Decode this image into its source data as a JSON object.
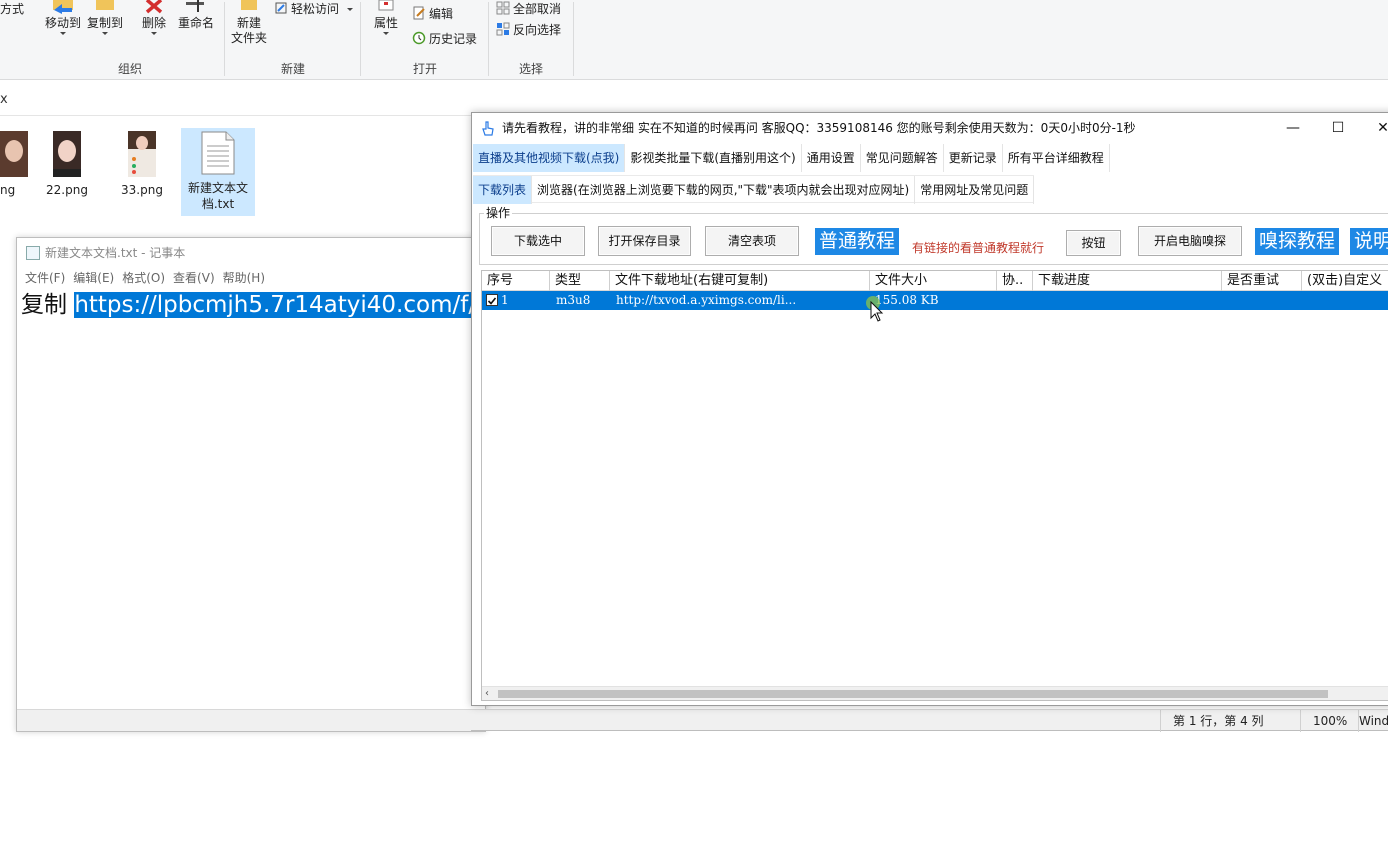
{
  "explorer": {
    "ribbon": {
      "partial_label": "方式",
      "organize": {
        "move_to": "移动到",
        "copy_to": "复制到",
        "delete": "删除",
        "rename": "重命名",
        "group": "组织"
      },
      "new": {
        "new_folder_line1": "新建",
        "new_folder_line2": "文件夹",
        "easy_access": "轻松访问",
        "group": "新建"
      },
      "open": {
        "properties": "属性",
        "edit": "编辑",
        "history": "历史记录",
        "group": "打开"
      },
      "select": {
        "select_none": "全部取消",
        "invert": "反向选择",
        "group": "选择"
      }
    },
    "address_partial": "x",
    "files": [
      {
        "name": "ng",
        "type": "image"
      },
      {
        "name": "22.png",
        "type": "image"
      },
      {
        "name": "33.png",
        "type": "image"
      },
      {
        "name": "新建文本文档.txt",
        "line1": "新建文本文",
        "line2": "档.txt",
        "type": "text",
        "selected": true
      }
    ]
  },
  "notepad": {
    "title": "新建文本文档.txt - 记事本",
    "menu": [
      "文件(F)",
      "编辑(E)",
      "格式(O)",
      "查看(V)",
      "帮助(H)"
    ],
    "text_prefix": "复制 ",
    "text_selected": "https://lpbcmjh5.7r14atyi40.com/f/",
    "status": {
      "position": "第 1 行，第 4 列",
      "zoom": "100%",
      "encoding_partial": "Wind"
    }
  },
  "downloader": {
    "title": "请先看教程，讲的非常细  实在不知道的时候再问   客服QQ：3359108146    您的账号剩余使用天数为：0天0小时0分-1秒",
    "controls": {
      "minimize": "—",
      "maximize": "☐",
      "close": "✕"
    },
    "tabs_top": [
      {
        "label": "直播及其他视频下载(点我)",
        "active": true
      },
      {
        "label": "影视类批量下载(直播别用这个)",
        "active": false
      },
      {
        "label": "通用设置",
        "active": false
      },
      {
        "label": "常见问题解答",
        "active": false
      },
      {
        "label": "更新记录",
        "active": false
      },
      {
        "label": "所有平台详细教程",
        "active": false
      }
    ],
    "tabs_sub": [
      {
        "label": "下载列表",
        "active": true
      },
      {
        "label": "浏览器(在浏览器上浏览要下载的网页,\"下载\"表项内就会出现对应网址)",
        "active": false
      },
      {
        "label": "常用网址及常见问题",
        "active": false
      }
    ],
    "ops": {
      "group_label": "操作",
      "download_selected": "下载选中",
      "open_save_dir": "打开保存目录",
      "clear_list": "清空表项",
      "normal_tutorial": "普通教程",
      "red_note": "有链接的看普通教程就行",
      "button": "按钮",
      "start_sniff": "开启电脑嗅探",
      "sniff_tutorial": "嗅探教程",
      "explain_partial": "说明"
    },
    "table": {
      "columns": [
        "序号",
        "类型",
        "文件下载地址(右键可复制)",
        "文件大小",
        "协..",
        "下载进度",
        "是否重试",
        "(双击)自定义"
      ],
      "rows": [
        {
          "index": "1",
          "type": "m3u8",
          "url": "http://txvod.a.yximgs.com/li...",
          "size": "155.08 KB",
          "protocol": "",
          "progress": "",
          "retry": "",
          "custom": "",
          "checked": true,
          "selected": true
        }
      ],
      "scroll_left": "‹"
    }
  }
}
